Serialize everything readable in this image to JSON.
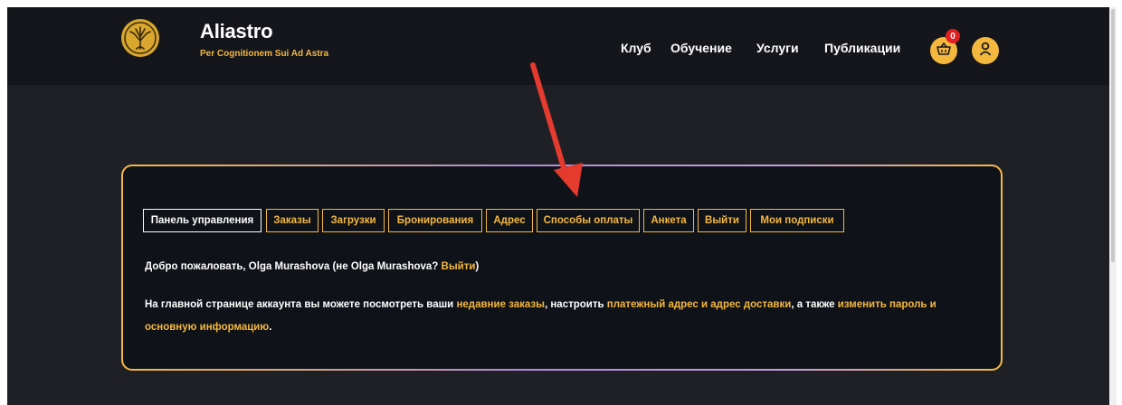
{
  "header": {
    "brand_name": "Aliastro",
    "tagline": "Per Cognitionem Sui Ad Astra",
    "nav": [
      "Клуб",
      "Обучение",
      "Услуги",
      "Публикации"
    ],
    "cart_count": "0",
    "icons": {
      "logo": "tree-of-life-emblem",
      "cart": "basket-icon",
      "account": "user-icon"
    }
  },
  "account": {
    "tabs": [
      {
        "label": "Панель управления",
        "active": true
      },
      {
        "label": "Заказы",
        "active": false
      },
      {
        "label": "Загрузки",
        "active": false
      },
      {
        "label": "Бронирования",
        "active": false
      },
      {
        "label": "Адрес",
        "active": false
      },
      {
        "label": "Способы оплаты",
        "active": false
      },
      {
        "label": "Анкета",
        "active": false
      },
      {
        "label": "Выйти",
        "active": false
      },
      {
        "label": "Мои подписки",
        "active": false
      }
    ],
    "welcome": {
      "prefix": "Добро пожаловать, Olga Murashova (не Olga Murashova? ",
      "logout_link": "Выйти",
      "suffix": ")"
    },
    "info": {
      "line1_part1": "На главной странице аккаунта вы можете посмотреть ваши ",
      "link_orders": "недавние заказы",
      "line1_part2": ", настроить ",
      "link_addresses": "платежный адрес и адрес доставки",
      "line1_part3": ", а также ",
      "link_password_1": "изменить пароль и",
      "link_password_2": "основную информацию",
      "line2_end": "."
    }
  },
  "colors": {
    "accent": "#f4b83f",
    "header_bg": "#15161b",
    "page_bg": "#1f2026",
    "panel_bg": "#0f1218",
    "badge": "#e02020",
    "arrow": "#e53a2e"
  }
}
